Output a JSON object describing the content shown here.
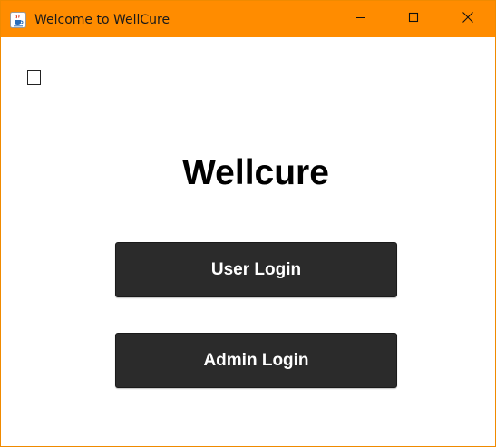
{
  "window": {
    "title": "Welcome to WellCure",
    "app_icon": "java-cup-icon",
    "controls": {
      "minimize_icon": "minimize-icon",
      "maximize_icon": "maximize-icon",
      "close_icon": "close-icon"
    },
    "titlebar_color": "#ff8c00"
  },
  "main": {
    "heading": "Wellcure",
    "checkbox_checked": false,
    "buttons": {
      "user_login": "User Login",
      "admin_login": "Admin Login"
    },
    "button_color": "#2b2b2b"
  }
}
